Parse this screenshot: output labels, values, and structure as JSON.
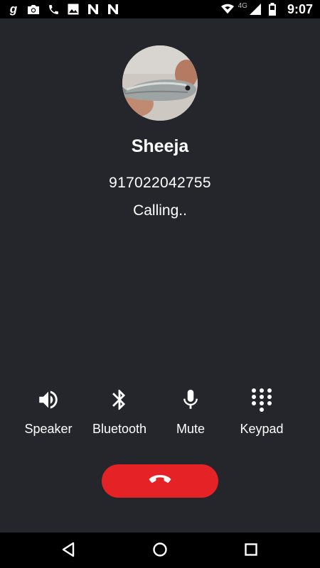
{
  "status_bar": {
    "left_icons": [
      "gboard-g-icon",
      "camera-icon",
      "phone-icon",
      "image-icon",
      "n-notification-icon",
      "n-notification-icon"
    ],
    "g_glyph": "g",
    "network_type": "4G",
    "time": "9:07"
  },
  "caller": {
    "name": "Sheeja",
    "number": "917022042755",
    "status": "Calling.."
  },
  "controls": [
    {
      "label": "Speaker",
      "icon": "speaker-icon"
    },
    {
      "label": "Bluetooth",
      "icon": "bluetooth-icon"
    },
    {
      "label": "Mute",
      "icon": "microphone-icon"
    },
    {
      "label": "Keypad",
      "icon": "keypad-icon"
    }
  ],
  "colors": {
    "background": "#24262b",
    "end_call": "#e52225",
    "bars": "#000000",
    "text": "#ffffff"
  }
}
